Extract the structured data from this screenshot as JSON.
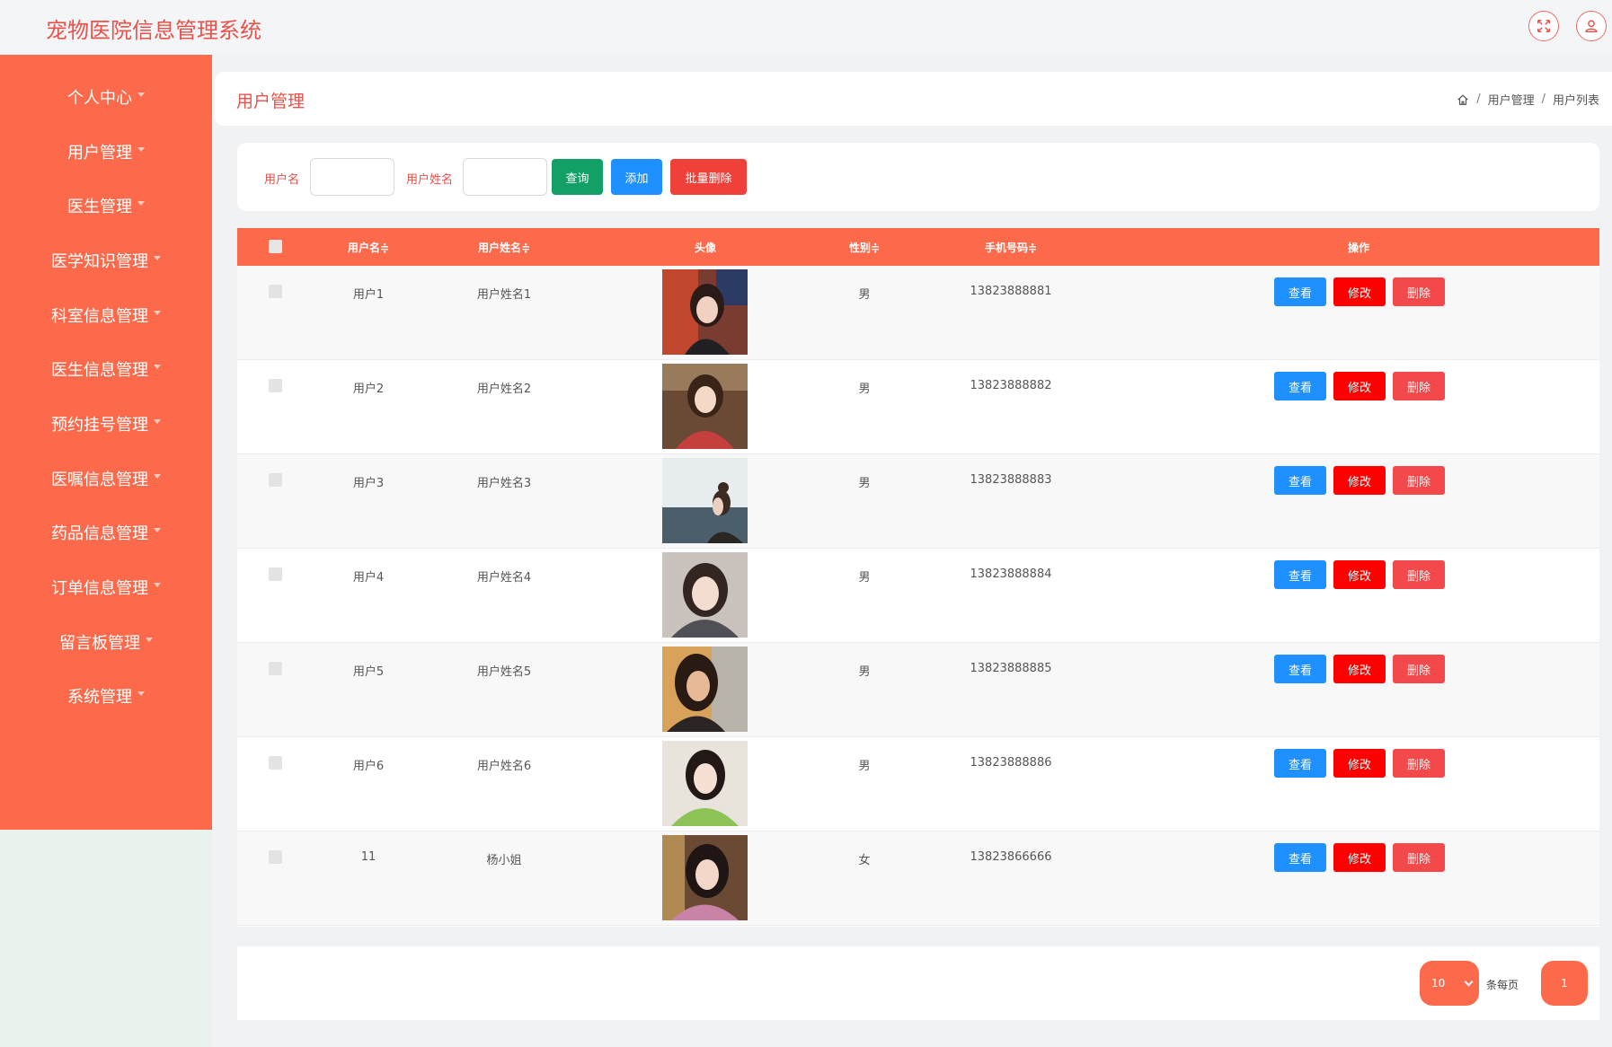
{
  "app": {
    "title": "宠物医院信息管理系统"
  },
  "topbar": {
    "icons": [
      "fullscreen-icon",
      "user-icon"
    ]
  },
  "sidebar": {
    "items": [
      {
        "label": "个人中心"
      },
      {
        "label": "用户管理"
      },
      {
        "label": "医生管理"
      },
      {
        "label": "医学知识管理"
      },
      {
        "label": "科室信息管理"
      },
      {
        "label": "医生信息管理"
      },
      {
        "label": "预约挂号管理"
      },
      {
        "label": "医嘱信息管理"
      },
      {
        "label": "药品信息管理"
      },
      {
        "label": "订单信息管理"
      },
      {
        "label": "留言板管理"
      },
      {
        "label": "系统管理"
      }
    ]
  },
  "header": {
    "title": "用户管理",
    "breadcrumb": [
      "用户管理",
      "用户列表"
    ],
    "separator": "/"
  },
  "search": {
    "username_label": "用户名",
    "username_value": "",
    "realname_label": "用户姓名",
    "realname_value": "",
    "query_label": "查询",
    "add_label": "添加",
    "batch_delete_label": "批量删除"
  },
  "table": {
    "columns": [
      "用户名≑",
      "用户姓名≑",
      "头像",
      "性别≑",
      "手机号码≑",
      "操作"
    ],
    "rows": [
      {
        "username": "用户1",
        "realname": "用户姓名1",
        "gender": "男",
        "phone": "13823888881"
      },
      {
        "username": "用户2",
        "realname": "用户姓名2",
        "gender": "男",
        "phone": "13823888882"
      },
      {
        "username": "用户3",
        "realname": "用户姓名3",
        "gender": "男",
        "phone": "13823888883"
      },
      {
        "username": "用户4",
        "realname": "用户姓名4",
        "gender": "男",
        "phone": "13823888884"
      },
      {
        "username": "用户5",
        "realname": "用户姓名5",
        "gender": "男",
        "phone": "13823888885"
      },
      {
        "username": "用户6",
        "realname": "用户姓名6",
        "gender": "男",
        "phone": "13823888886"
      },
      {
        "username": "11",
        "realname": "杨小姐",
        "gender": "女",
        "phone": "13823866666"
      }
    ],
    "actions": {
      "view": "查看",
      "edit": "修改",
      "delete": "删除"
    }
  },
  "pagination": {
    "page_size": "10",
    "per_page_label": "条每页",
    "current_page": "1"
  },
  "colors": {
    "accent": "#fd6a4b",
    "title": "#e8524a",
    "query_btn": "#13a067",
    "add_btn": "#1e90ff",
    "batch_delete_btn": "#f0403a",
    "view_btn": "#1e90ff",
    "edit_btn": "#ff0000",
    "delete_btn": "#f4494b"
  }
}
